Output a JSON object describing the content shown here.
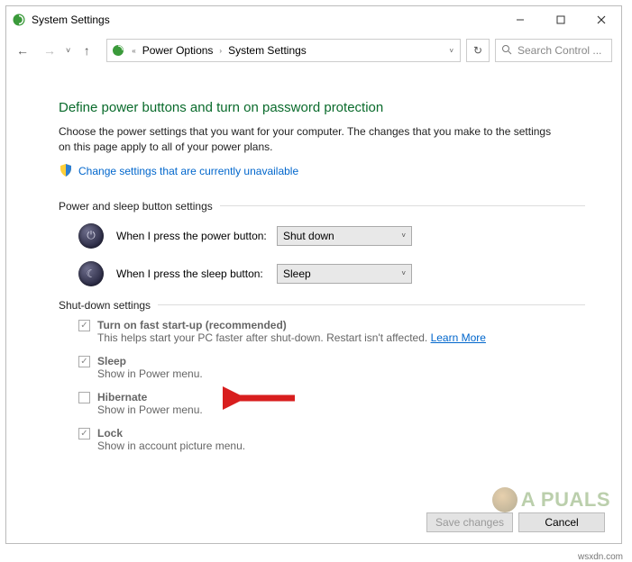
{
  "titlebar": {
    "title": "System Settings"
  },
  "toolbar": {
    "crumb1": "Power Options",
    "crumb2": "System Settings",
    "search_placeholder": "Search Control ...",
    "ellipsis": "«"
  },
  "main": {
    "heading": "Define power buttons and turn on password protection",
    "description": "Choose the power settings that you want for your computer. The changes that you make to the settings on this page apply to all of your power plans.",
    "admin_link": "Change settings that are currently unavailable",
    "section1_title": "Power and sleep button settings",
    "power_label": "When I press the power button:",
    "power_value": "Shut down",
    "sleep_label": "When I press the sleep button:",
    "sleep_value": "Sleep",
    "section2_title": "Shut-down settings",
    "opts": {
      "fast": {
        "title": "Turn on fast start-up (recommended)",
        "sub": "This helps start your PC faster after shut-down. Restart isn't affected. ",
        "link": "Learn More"
      },
      "sleep": {
        "title": "Sleep",
        "sub": "Show in Power menu."
      },
      "hibernate": {
        "title": "Hibernate",
        "sub": "Show in Power menu."
      },
      "lock": {
        "title": "Lock",
        "sub": "Show in account picture menu."
      }
    }
  },
  "footer": {
    "save": "Save changes",
    "cancel": "Cancel"
  },
  "watermark": "A  PUALS",
  "credit": "wsxdn.com"
}
